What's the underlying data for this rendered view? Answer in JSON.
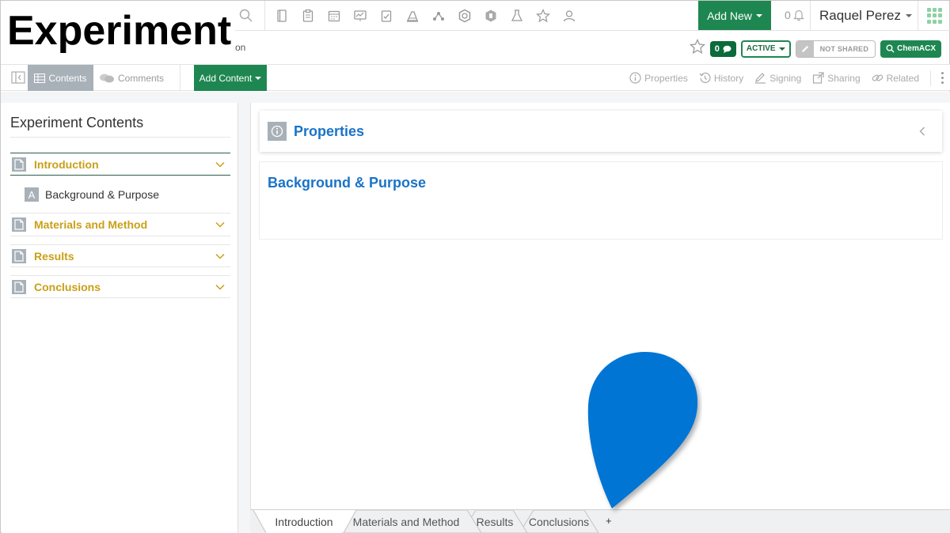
{
  "overlay": {
    "heading": "Experiment"
  },
  "topbar": {
    "add_new_label": "Add New",
    "notification_count": "0",
    "user_name": "Raquel Perez",
    "tool_icons": [
      "notebook-icon",
      "clipboard-icon",
      "calendar-icon",
      "presentation-icon",
      "checklist-icon",
      "lab-equipment-icon",
      "molecule-icon",
      "hexagon-compound-icon",
      "container-icon",
      "flask-icon",
      "favorites-star-icon",
      "user-group-icon"
    ]
  },
  "header": {
    "breadcrumb_tail": "on",
    "comments_count": "0",
    "status_label": "ACTIVE",
    "share_label": "NOT SHARED",
    "chemacx_label": "ChemACX"
  },
  "toolbar": {
    "contents_tab": "Contents",
    "comments_tab": "Comments",
    "add_content_label": "Add Content",
    "right_tabs": [
      "Properties",
      "History",
      "Signing",
      "Sharing",
      "Related"
    ]
  },
  "sidebar": {
    "title": "Experiment Contents",
    "sections": [
      {
        "label": "Introduction",
        "expanded": true
      },
      {
        "label": "Materials and Method",
        "expanded": false
      },
      {
        "label": "Results",
        "expanded": false
      },
      {
        "label": "Conclusions",
        "expanded": false
      }
    ],
    "sub_items": [
      {
        "icon_letter": "A",
        "label": "Background & Purpose"
      }
    ]
  },
  "main": {
    "properties_title": "Properties",
    "section_title": "Background & Purpose"
  },
  "bottom_tabs": {
    "tabs": [
      "Introduction",
      "Materials and Method",
      "Results",
      "Conclusions"
    ],
    "active_tab": "Introduction",
    "add_label": "+"
  },
  "colors": {
    "brand_green": "#1e8751",
    "section_gold": "#c9a017",
    "link_blue": "#1a73c8",
    "pin_blue": "#0074d4",
    "icon_gray": "#a8b0b8"
  }
}
